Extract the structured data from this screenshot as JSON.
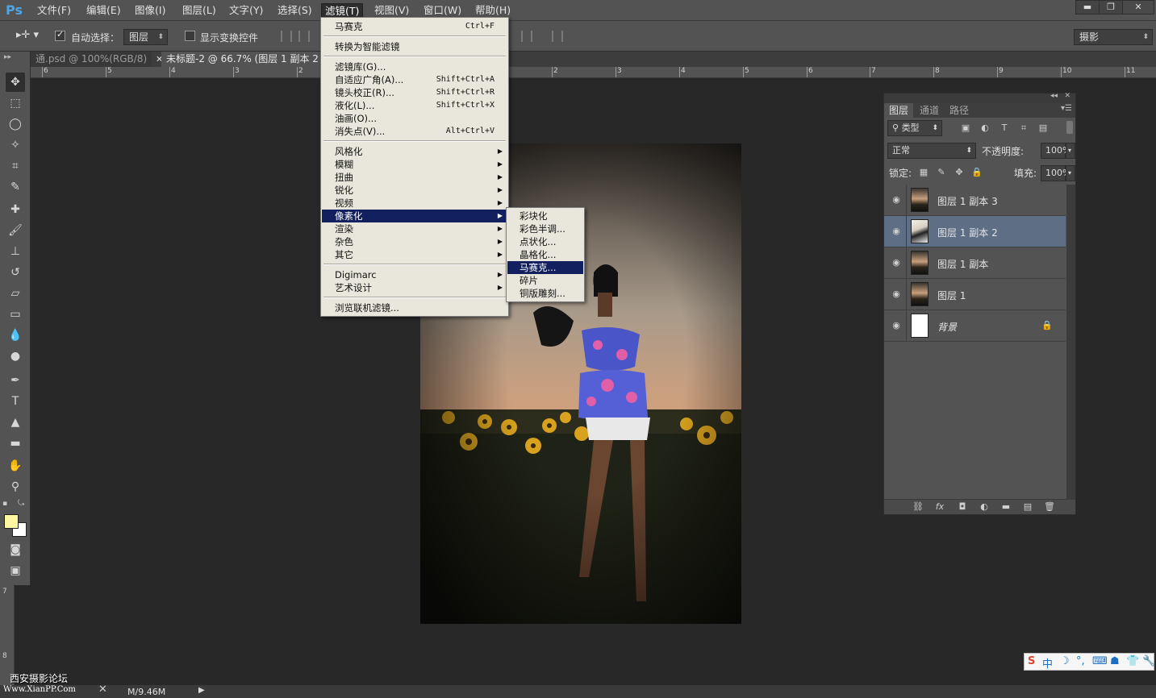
{
  "app": {
    "logo": "Ps"
  },
  "menubar": {
    "items": [
      {
        "label": "文件(F)"
      },
      {
        "label": "编辑(E)"
      },
      {
        "label": "图像(I)"
      },
      {
        "label": "图层(L)"
      },
      {
        "label": "文字(Y)"
      },
      {
        "label": "选择(S)"
      },
      {
        "label": "滤镜(T)"
      },
      {
        "label": "视图(V)"
      },
      {
        "label": "窗口(W)"
      },
      {
        "label": "帮助(H)"
      }
    ],
    "window_controls": {
      "minimize": "▬",
      "restore": "❐",
      "close": "✕"
    }
  },
  "options_bar": {
    "auto_select_label": "自动选择：",
    "auto_select_checked": true,
    "auto_select_target": "图层",
    "show_transform_label": "显示变换控件",
    "show_transform_checked": false,
    "workspace": "摄影"
  },
  "tabs": [
    {
      "label": "通.psd @ 100%(RGB/8)",
      "active": false
    },
    {
      "label": "未标题-2 @ 66.7% (图层 1 副本 2",
      "active": true
    }
  ],
  "ruler": {
    "h_ticks": [
      "6",
      "5",
      "4",
      "3",
      "2",
      "1",
      "2",
      "3",
      "4",
      "5",
      "6",
      "7",
      "8",
      "9",
      "10",
      "11"
    ],
    "v_ticks": [
      "7",
      "8"
    ]
  },
  "filter_menu": {
    "items": [
      {
        "label": "马赛克",
        "shortcut": "Ctrl+F"
      },
      {
        "sep": true
      },
      {
        "label": "转换为智能滤镜"
      },
      {
        "sep": true
      },
      {
        "label": "滤镜库(G)..."
      },
      {
        "label": "自适应广角(A)...",
        "shortcut": "Shift+Ctrl+A"
      },
      {
        "label": "镜头校正(R)...",
        "shortcut": "Shift+Ctrl+R"
      },
      {
        "label": "液化(L)...",
        "shortcut": "Shift+Ctrl+X"
      },
      {
        "label": "油画(O)..."
      },
      {
        "label": "消失点(V)...",
        "shortcut": "Alt+Ctrl+V"
      },
      {
        "sep": true
      },
      {
        "label": "风格化",
        "submenu": true
      },
      {
        "label": "模糊",
        "submenu": true
      },
      {
        "label": "扭曲",
        "submenu": true
      },
      {
        "label": "锐化",
        "submenu": true
      },
      {
        "label": "视频",
        "submenu": true
      },
      {
        "label": "像素化",
        "submenu": true,
        "highlight": true
      },
      {
        "label": "渲染",
        "submenu": true
      },
      {
        "label": "杂色",
        "submenu": true
      },
      {
        "label": "其它",
        "submenu": true
      },
      {
        "sep": true
      },
      {
        "label": "Digimarc",
        "submenu": true
      },
      {
        "label": "艺术设计",
        "submenu": true
      },
      {
        "sep": true
      },
      {
        "label": "浏览联机滤镜..."
      }
    ]
  },
  "pixelate_submenu": {
    "items": [
      {
        "label": "彩块化"
      },
      {
        "label": "彩色半调..."
      },
      {
        "label": "点状化..."
      },
      {
        "label": "晶格化..."
      },
      {
        "label": "马赛克...",
        "highlight": true
      },
      {
        "label": "碎片"
      },
      {
        "label": "铜版雕刻..."
      }
    ]
  },
  "layers_panel": {
    "tabs": [
      {
        "label": "图层",
        "active": true
      },
      {
        "label": "通道",
        "active": false
      },
      {
        "label": "路径",
        "active": false
      }
    ],
    "filter_kind": "类型",
    "blend_mode": "正常",
    "opacity_label": "不透明度:",
    "opacity_value": "100%",
    "lock_label": "锁定:",
    "fill_label": "填充:",
    "fill_value": "100%",
    "layers": [
      {
        "name": "图层 1 副本 3",
        "selected": false,
        "italic": false,
        "locked": false,
        "thumb": "photo"
      },
      {
        "name": "图层 1 副本 2",
        "selected": true,
        "italic": false,
        "locked": false,
        "thumb": "photo-alt"
      },
      {
        "name": "图层 1 副本",
        "selected": false,
        "italic": false,
        "locked": false,
        "thumb": "photo"
      },
      {
        "name": "图层 1",
        "selected": false,
        "italic": false,
        "locked": false,
        "thumb": "photo"
      },
      {
        "name": "背景",
        "selected": false,
        "italic": true,
        "locked": true,
        "thumb": "white"
      }
    ]
  },
  "status": {
    "doc_size": "M/9.46M",
    "watermark_title": "西安摄影论坛",
    "watermark_url": "Www.XianPP.Com"
  },
  "ime": {
    "items": [
      "S",
      "中",
      "☽",
      "°,",
      "⌨",
      "☗",
      "👕",
      "🔧"
    ]
  },
  "colors": {
    "foreground": "#fdf7a1",
    "background": "#ffffff",
    "menu_highlight": "#13205f",
    "layer_selected": "#5d6e85",
    "ps_blue": "#4fa6e6"
  }
}
